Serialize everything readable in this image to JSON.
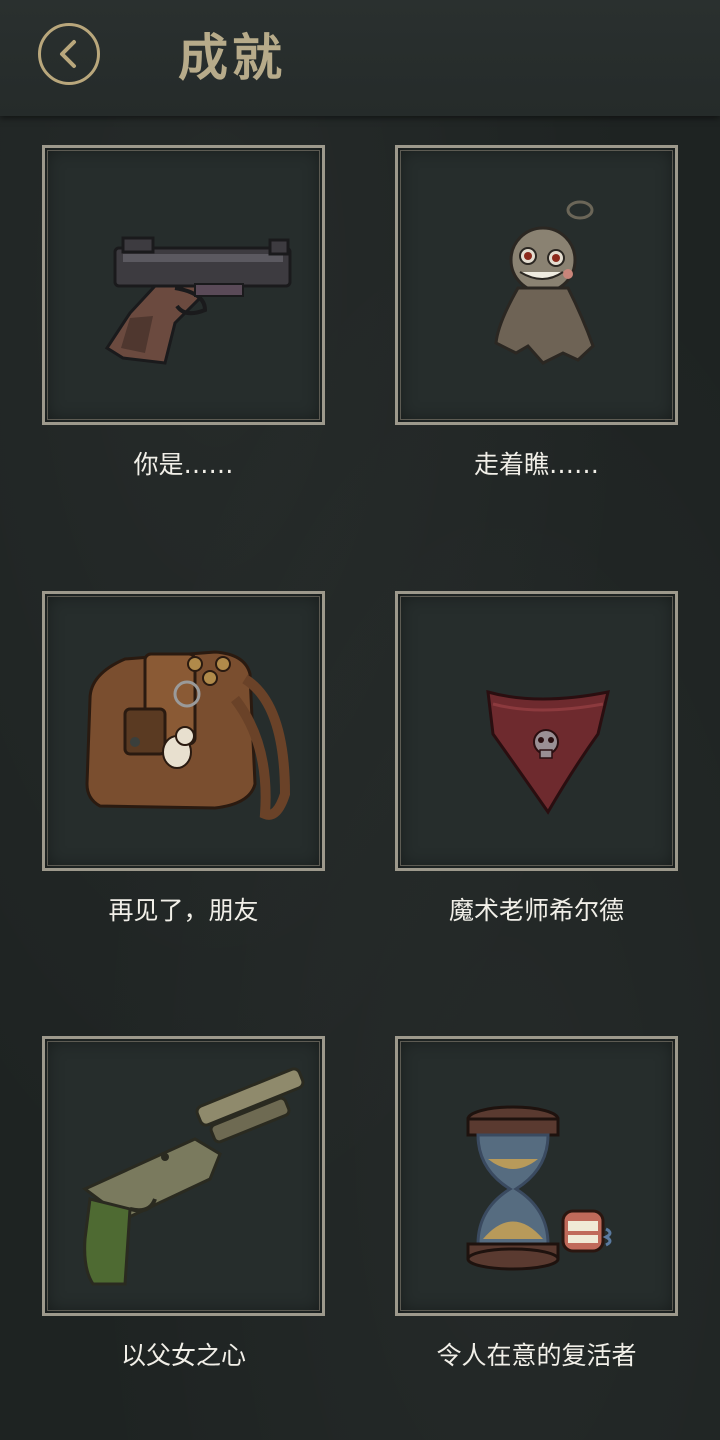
{
  "header": {
    "title": "成就"
  },
  "achievements": [
    {
      "label": "你是……",
      "icon": "pistol-icon"
    },
    {
      "label": "走着瞧……",
      "icon": "teru-teru-doll-icon"
    },
    {
      "label": "再见了，朋友",
      "icon": "leather-bag-icon"
    },
    {
      "label": "魔术老师希尔德",
      "icon": "skull-bandana-icon"
    },
    {
      "label": "以父女之心",
      "icon": "shotgun-icon"
    },
    {
      "label": "令人在意的复活者",
      "icon": "hourglass-dentures-icon"
    }
  ],
  "colors": {
    "background": "#1e2322",
    "header": "#2a302f",
    "title": "#b7ab8a",
    "frame_border": "#9d998c",
    "label": "#f1efe8"
  }
}
